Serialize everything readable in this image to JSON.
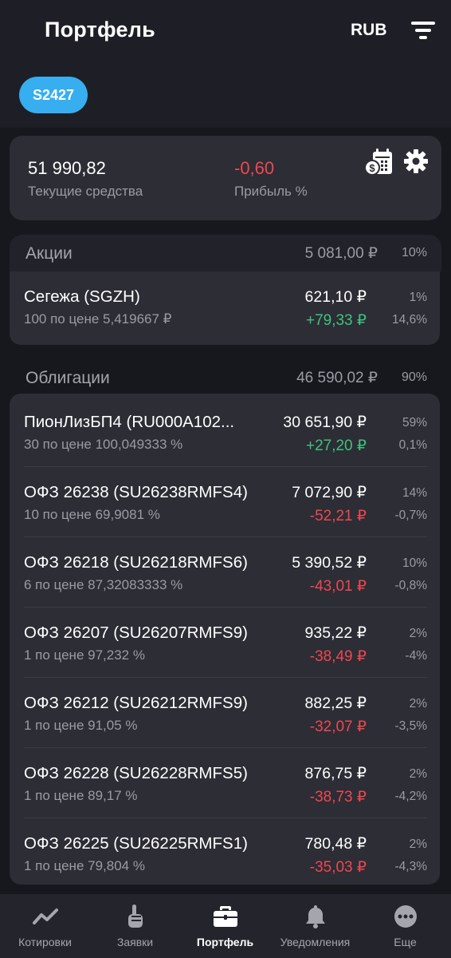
{
  "header": {
    "title": "Портфель",
    "currency": "RUB",
    "account": "S2427"
  },
  "summary": {
    "current_funds_value": "51 990,82",
    "current_funds_label": "Текущие средства",
    "profit_value": "-0,60",
    "profit_label": "Прибыль %"
  },
  "sections": [
    {
      "name": "Акции",
      "sum": "5 081,00 ₽",
      "pct": "10%",
      "items": [
        {
          "name": "Сегежа (SGZH)",
          "sub": "100 по цене 5,419667 ₽",
          "price": "621,10 ₽",
          "change": "+79,33 ₽",
          "share": "1%",
          "dpct": "14,6%",
          "positive": true
        }
      ]
    },
    {
      "name": "Облигации",
      "sum": "46 590,02 ₽",
      "pct": "90%",
      "items": [
        {
          "name": "ПионЛизБП4 (RU000A102...",
          "sub": "30 по цене 100,049333 %",
          "price": "30 651,90 ₽",
          "change": "+27,20 ₽",
          "share": "59%",
          "dpct": "0,1%",
          "positive": true
        },
        {
          "name": "ОФЗ 26238 (SU26238RMFS4)",
          "sub": "10 по цене 69,9081 %",
          "price": "7 072,90 ₽",
          "change": "-52,21 ₽",
          "share": "14%",
          "dpct": "-0,7%",
          "positive": false
        },
        {
          "name": "ОФЗ 26218 (SU26218RMFS6)",
          "sub": "6 по цене 87,32083333 %",
          "price": "5 390,52 ₽",
          "change": "-43,01 ₽",
          "share": "10%",
          "dpct": "-0,8%",
          "positive": false
        },
        {
          "name": "ОФЗ 26207 (SU26207RMFS9)",
          "sub": "1 по цене 97,232 %",
          "price": "935,22 ₽",
          "change": "-38,49 ₽",
          "share": "2%",
          "dpct": "-4%",
          "positive": false
        },
        {
          "name": "ОФЗ 26212 (SU26212RMFS9)",
          "sub": "1 по цене 91,05 %",
          "price": "882,25 ₽",
          "change": "-32,07 ₽",
          "share": "2%",
          "dpct": "-3,5%",
          "positive": false
        },
        {
          "name": "ОФЗ 26228 (SU26228RMFS5)",
          "sub": "1 по цене 89,17 %",
          "price": "876,75 ₽",
          "change": "-38,73 ₽",
          "share": "2%",
          "dpct": "-4,2%",
          "positive": false
        },
        {
          "name": "ОФЗ 26225 (SU26225RMFS1)",
          "sub": "1 по цене 79,804 %",
          "price": "780,48 ₽",
          "change": "-35,03 ₽",
          "share": "2%",
          "dpct": "-4,3%",
          "positive": false
        }
      ]
    }
  ],
  "nav": {
    "items": [
      {
        "label": "Котировки",
        "icon": "chart-line-icon"
      },
      {
        "label": "Заявки",
        "icon": "hand-icon"
      },
      {
        "label": "Портфель",
        "icon": "briefcase-icon",
        "active": true
      },
      {
        "label": "Уведомления",
        "icon": "bell-icon"
      },
      {
        "label": "Еще",
        "icon": "more-dots-icon"
      }
    ]
  },
  "colors": {
    "accent": "#36aef0",
    "positive": "#3fc27f",
    "negative": "#f0474f",
    "background": "#17181d",
    "card": "#2c2d35"
  }
}
